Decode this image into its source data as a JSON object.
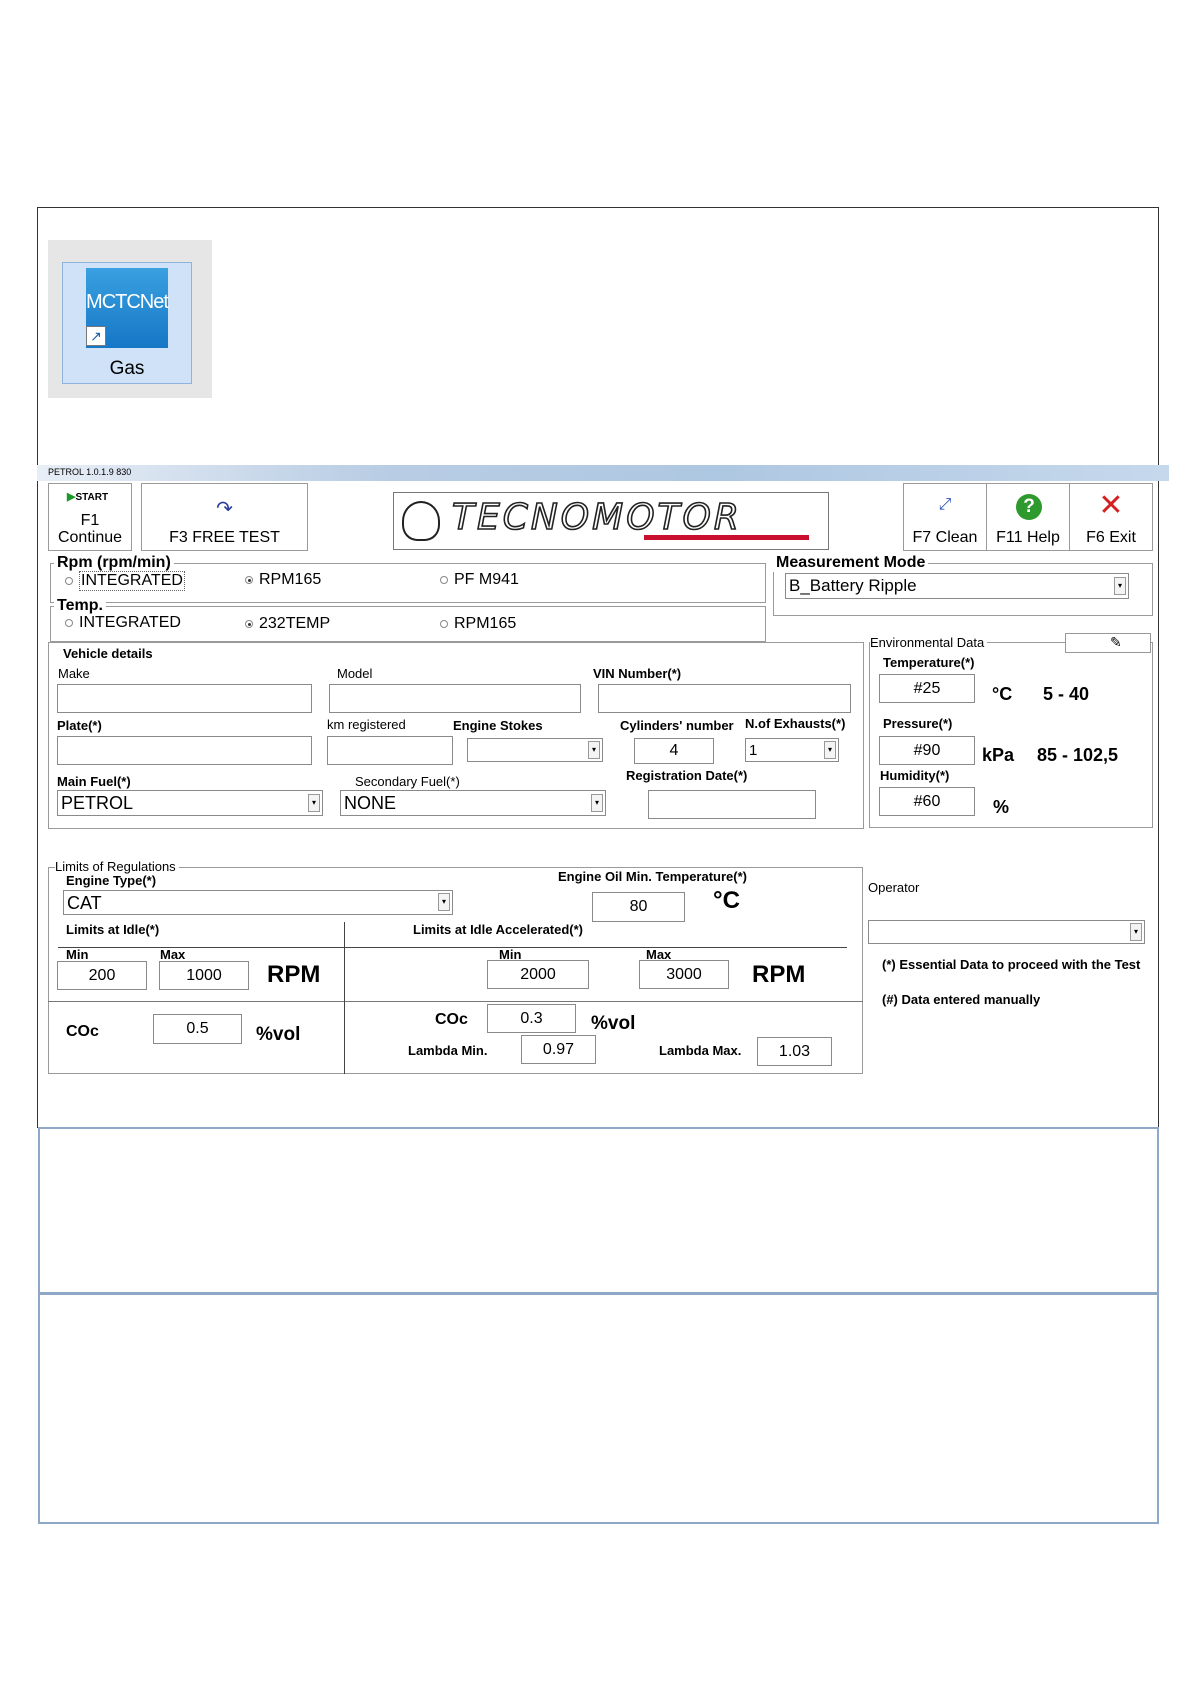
{
  "shortcut": {
    "logo_text": "MCTCNet",
    "label": "Gas"
  },
  "titlebar": {
    "version": "PETROL 1.0.1.9 830"
  },
  "toolbar": {
    "start_badge": "START",
    "f1_key": "F1",
    "f1_label": "Continue",
    "f3_label": "F3 FREE TEST",
    "logo_text": "TECNOMOTOR",
    "f7_label": "F7 Clean",
    "f11_label": "F11 Help",
    "f6_label": "F6 Exit"
  },
  "rpm": {
    "title": "Rpm (rpm/min)",
    "options": [
      "INTEGRATED",
      "RPM165",
      "PF M941"
    ],
    "selected": "RPM165"
  },
  "temp": {
    "title": "Temp.",
    "options": [
      "INTEGRATED",
      "232TEMP",
      "RPM165"
    ],
    "selected": "232TEMP"
  },
  "measurement_mode": {
    "title": "Measurement Mode",
    "value": "B_Battery Ripple"
  },
  "vehicle": {
    "title": "Vehicle details",
    "make_label": "Make",
    "make": "",
    "model_label": "Model",
    "model": "",
    "vin_label": "VIN Number(*)",
    "vin": "",
    "plate_label": "Plate(*)",
    "plate": "",
    "km_label": "km registered",
    "km": "",
    "stokes_label": "Engine Stokes",
    "stokes": "",
    "cylinders_label": "Cylinders' number",
    "cylinders": "4",
    "exhausts_label": "N.of Exhausts(*)",
    "exhausts": "1",
    "main_fuel_label": "Main Fuel(*)",
    "main_fuel": "PETROL",
    "secondary_fuel_label": "Secondary Fuel(*)",
    "secondary_fuel": "NONE",
    "reg_date_label": "Registration Date(*)",
    "reg_date": ""
  },
  "env": {
    "title": "Environmental Data",
    "temp_label": "Temperature(*)",
    "temp": "#25",
    "temp_unit": "°C",
    "temp_range": "5 - 40",
    "pressure_label": "Pressure(*)",
    "pressure": "#90",
    "pressure_unit": "kPa",
    "pressure_range": "85 - 102,5",
    "humidity_label": "Humidity(*)",
    "humidity": "#60",
    "humidity_unit": "%"
  },
  "limits": {
    "title": "Limits of Regulations",
    "engine_type_label": "Engine Type(*)",
    "engine_type": "CAT",
    "oil_label": "Engine Oil Min. Temperature(*)",
    "oil_temp": "80",
    "oil_unit": "°C",
    "idle_label": "Limits at Idle(*)",
    "idle_accel_label": "Limits at Idle Accelerated(*)",
    "min_label": "Min",
    "max_label": "Max",
    "idle_min": "200",
    "idle_max": "1000",
    "accel_min": "2000",
    "accel_max": "3000",
    "rpm_unit": "RPM",
    "co_label": "COc",
    "idle_co": "0.5",
    "accel_co": "0.3",
    "vol_unit": "%vol",
    "lambda_min_label": "Lambda Min.",
    "lambda_min": "0.97",
    "lambda_max_label": "Lambda Max.",
    "lambda_max": "1.03"
  },
  "operator": {
    "label": "Operator",
    "value": ""
  },
  "notes": {
    "essential": "(*) Essential Data to proceed with the Test",
    "manual": "(#) Data entered manually"
  }
}
